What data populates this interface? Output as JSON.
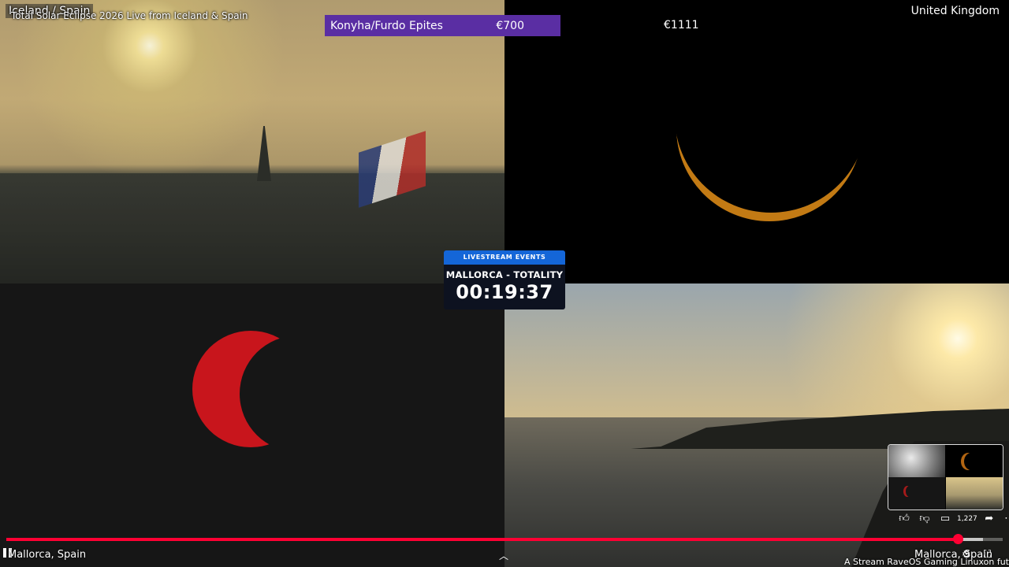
{
  "stream": {
    "top_left_label": "Iceland / Spain",
    "video_title": "Total Solar Eclipse 2026 Live from Iceland & Spain",
    "top_right_label": "United Kingdom",
    "bottom_left_label": "Mallorca, Spain",
    "bottom_right_label": "Mallorca, Spain",
    "ticker": "A Stream RaveOS Gaming Linuxon fut"
  },
  "donation": {
    "name": "Konyha/Furdo Epites",
    "amount": "€700",
    "amount_secondary": "€1111",
    "bar_color": "#5a2ea3"
  },
  "event": {
    "header": "LIVESTREAM EVENTS",
    "name": "MALLORCA - TOTALITY",
    "timer": "00:19:37",
    "header_color": "#1466d8"
  },
  "player": {
    "progress": 0.955,
    "buffer": 0.98,
    "progress_color": "#ff0033",
    "like_count": "1,227",
    "icons": [
      "pause-icon",
      "expand-icon",
      "settings-icon",
      "fullscreen-icon",
      "like-icon",
      "dislike-icon",
      "comment-icon",
      "share-icon",
      "more-icon"
    ]
  },
  "eclipse": {
    "crescent_color": "#c27a14",
    "red_sun_color": "#c8151c"
  }
}
